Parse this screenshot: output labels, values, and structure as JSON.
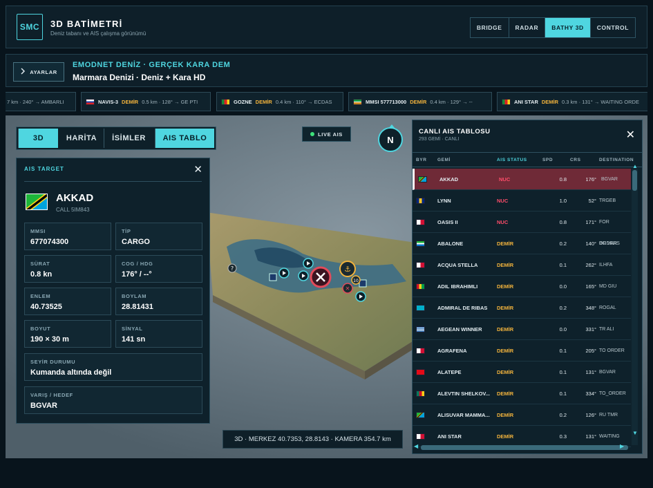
{
  "header": {
    "logo": "SMC",
    "title": "3D BATİMETRİ",
    "subtitle": "Deniz tabanı ve AIS çalışma görünümü",
    "modes": [
      {
        "label": "BRIDGE"
      },
      {
        "label": "RADAR"
      },
      {
        "label": "BATHY 3D",
        "active": true
      },
      {
        "label": "CONTROL"
      }
    ]
  },
  "subbar": {
    "button": "AYARLAR",
    "source": "EMODNET DENİZ · GERÇEK KARA DEM",
    "area": "Marmara Denizi · Deniz + Kara HD"
  },
  "ticker": [
    {
      "text": "7 km · 240° → AMBARLI"
    },
    {
      "name": "NAVIS-3",
      "status": "DEMİR",
      "info": "0.5 km · 128° → GE PTI"
    },
    {
      "name": "GOZNE",
      "status": "DEMİR",
      "info": "0.4 km · 110° → ECDAS"
    },
    {
      "name": "MMSI 577713000",
      "status": "DEMİR",
      "info": "0.4 km · 129° → --"
    },
    {
      "name": "ANI STAR",
      "status": "DEMİR",
      "info": "0.3 km · 131° → WAITING ORDE"
    }
  ],
  "view": {
    "tabs": [
      {
        "label": "3D",
        "active": true
      },
      {
        "label": "HARİTA"
      },
      {
        "label": "İSİMLER"
      },
      {
        "label": "AIS TABLO",
        "active": true
      }
    ],
    "live": "LIVE AIS",
    "compass": "N",
    "status": "3D · MERKEZ 40.7353, 28.8143 · KAMERA 354.7 km",
    "marker_badge": "10",
    "unknown_marker": "?"
  },
  "target": {
    "heading": "AIS TARGET",
    "name": "AKKAD",
    "call": "CALL 5IM843",
    "fields": [
      {
        "key": "MMSI",
        "value": "677074300"
      },
      {
        "key": "TİP",
        "value": "CARGO"
      },
      {
        "key": "SÜRAT",
        "value": "0.8 kn"
      },
      {
        "key": "COG / HDG",
        "value": "176° / --°"
      },
      {
        "key": "ENLEM",
        "value": "40.73525"
      },
      {
        "key": "BOYLAM",
        "value": "28.81431"
      },
      {
        "key": "BOYUT",
        "value": "190 × 30 m"
      },
      {
        "key": "SİNYAL",
        "value": "141 sn"
      },
      {
        "key": "SEYİR DURUMU",
        "value": "Kumanda altında değil"
      },
      {
        "key": "VARIŞ / HEDEF",
        "value": "BGVAR"
      }
    ]
  },
  "ais_table": {
    "title": "CANLI AIS TABLOSU",
    "subtitle": "293 GEMİ · CANLI",
    "columns": [
      "BYR",
      "GEMİ",
      "AIS STATUS",
      "SPD",
      "CRS",
      "DESTINATION"
    ],
    "rows": [
      {
        "flag": "tz",
        "name": "AKKAD",
        "status": "NUC",
        "spd": "0.8",
        "crs": "176°",
        "dest": "BGVAR",
        "selected": true
      },
      {
        "flag": "bb",
        "name": "LYNN",
        "status": "NUC",
        "spd": "1.0",
        "crs": "52°",
        "dest": "TRGEB"
      },
      {
        "flag": "pa",
        "name": "OASIS II",
        "status": "NUC",
        "spd": "0.8",
        "crs": "171°",
        "dest": "FOR ORDERS"
      },
      {
        "flag": "sl",
        "name": "ABALONE",
        "status": "DEMİR",
        "spd": "0.2",
        "crs": "140°",
        "dest": "BG VAR"
      },
      {
        "flag": "pa",
        "name": "ACQUA STELLA",
        "status": "DEMİR",
        "spd": "0.1",
        "crs": "262°",
        "dest": "ILHFA"
      },
      {
        "flag": "gw",
        "name": "ADIL IBRAHIMLI",
        "status": "DEMİR",
        "spd": "0.0",
        "crs": "165°",
        "dest": "MD GIU"
      },
      {
        "flag": "kz",
        "name": "ADMIRAL DE RIBAS",
        "status": "DEMİR",
        "spd": "0.2",
        "crs": "348°",
        "dest": "ROGAL"
      },
      {
        "flag": "gr",
        "name": "AEGEAN WINNER",
        "status": "DEMİR",
        "spd": "0.0",
        "crs": "331°",
        "dest": "TR ALI"
      },
      {
        "flag": "pa",
        "name": "AGRAFENA",
        "status": "DEMİR",
        "spd": "0.1",
        "crs": "205°",
        "dest": "TO ORDER"
      },
      {
        "flag": "tr",
        "name": "ALATEPE",
        "status": "DEMİR",
        "spd": "0.1",
        "crs": "131°",
        "dest": "BGVAR"
      },
      {
        "flag": "cm",
        "name": "ALEVTIN SHELKOV...",
        "status": "DEMİR",
        "spd": "0.1",
        "crs": "334°",
        "dest": "TO_ORDER"
      },
      {
        "flag": "tz",
        "name": "ALISUVAR MAMMA...",
        "status": "DEMİR",
        "spd": "0.2",
        "crs": "126°",
        "dest": "RU TMR"
      },
      {
        "flag": "pa",
        "name": "ANI STAR",
        "status": "DEMİR",
        "spd": "0.3",
        "crs": "131°",
        "dest": "WAITING ORD"
      }
    ]
  },
  "colors": {
    "accent": "#4fd6e0",
    "nuc": "#ff4d6a",
    "anchor": "#f2b33c",
    "selected_row": "#6f2a37"
  }
}
